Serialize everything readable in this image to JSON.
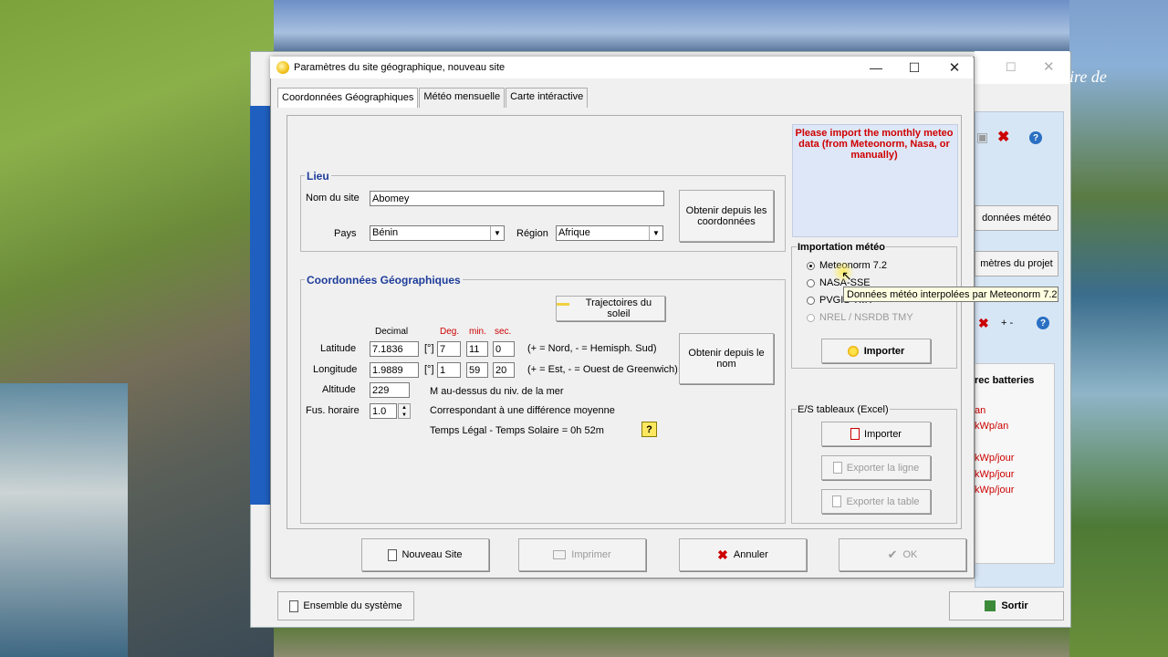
{
  "back_window": {
    "title_fragment": "ire de",
    "buttons": {
      "meteo": "données météo",
      "project": "mètres du projet",
      "exit": "Sortir",
      "system": "Ensemble du système"
    },
    "section_title": "rec batteries",
    "values": [
      "an",
      "kWp/an",
      "kWp/jour",
      "kWp/jour",
      "kWp/jour"
    ],
    "add_label": "+ -"
  },
  "dialog": {
    "title": "Paramètres du site géographique, nouveau site",
    "tabs": [
      "Coordonnées Géographiques",
      "Météo mensuelle",
      "Carte intéractive"
    ],
    "lieu": {
      "legend": "Lieu",
      "site_label": "Nom du site",
      "site_value": "Abomey",
      "country_label": "Pays",
      "country_value": "Bénin",
      "region_label": "Région",
      "region_value": "Afrique",
      "from_coords_button": "Obtenir depuis les coordonnées"
    },
    "coords": {
      "legend": "Coordonnées Géographiques",
      "sun_paths_button": "Trajectoires du soleil",
      "headers": {
        "decimal": "Decimal",
        "deg": "Deg.",
        "min": "min.",
        "sec": "sec."
      },
      "latitude": {
        "label": "Latitude",
        "decimal": "7.1836",
        "unit": "[°]",
        "deg": "7",
        "min": "11",
        "sec": "0",
        "note": "(+ = Nord,  - = Hemisph. Sud)"
      },
      "longitude": {
        "label": "Longitude",
        "decimal": "1.9889",
        "unit": "[°]",
        "deg": "1",
        "min": "59",
        "sec": "20",
        "note": "(+ = Est, - = Ouest de Greenwich)"
      },
      "altitude": {
        "label": "Altitude",
        "value": "229",
        "note": "M au-dessus du niv. de la mer"
      },
      "timezone": {
        "label": "Fus. horaire",
        "value": "1.0",
        "note": "Correspondant à une différence moyenne"
      },
      "legal_solar": "Temps Légal - Temps Solaire =   0h 52m",
      "from_name_button": "Obtenir depuis le nom",
      "help": "?"
    },
    "info_message": "Please import the monthly meteo data (from Meteonorm, Nasa, or manually)",
    "import": {
      "legend": "Importation météo",
      "options": [
        "Meteonorm 7.2",
        "NASA-SSE",
        "PVGIS TMY",
        "NREL / NSRDB TMY"
      ],
      "selected": "Meteonorm 7.2",
      "button": "Importer",
      "tooltip": "Données météo interpolées par Meteonorm 7.2"
    },
    "excel": {
      "legend": "E/S tableaux (Excel)",
      "import_button": "Importer",
      "export_row_button": "Exporter la ligne",
      "export_table_button": "Exporter la table"
    },
    "footer": {
      "new_site": "Nouveau Site",
      "print": "Imprimer",
      "cancel": "Annuler",
      "ok": "OK"
    }
  }
}
